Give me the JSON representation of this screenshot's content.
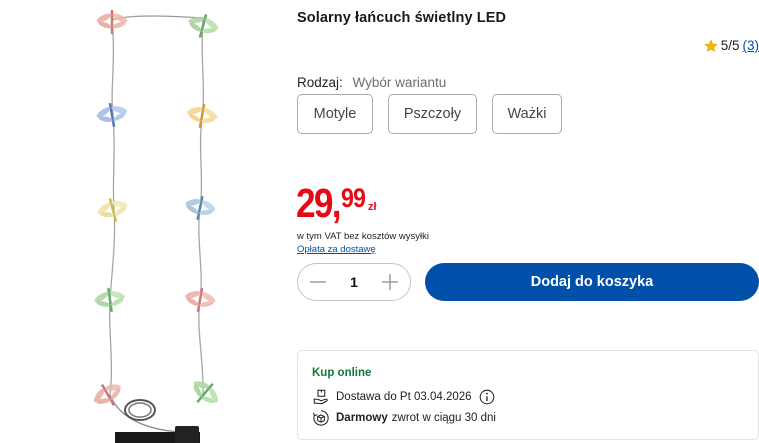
{
  "product": {
    "title": "Solarny łańcuch świetlny LED",
    "rating_score": "5/5",
    "rating_count": "(3)"
  },
  "variant": {
    "label": "Rodzaj:",
    "hint": "Wybór wariantu",
    "options": [
      "Motyle",
      "Pszczoły",
      "Ważki"
    ]
  },
  "price": {
    "main": "29,",
    "cents": "99",
    "currency": "zł",
    "vat_note": "w tym VAT bez kosztów wysyłki",
    "shipping_link": "Opłata za dostawę",
    "color": "#e60a14"
  },
  "cart": {
    "quantity": "1",
    "add_button": "Dodaj do koszyka",
    "accent": "#0050aa"
  },
  "online": {
    "heading": "Kup online",
    "delivery": "Dostawa do Pt 03.04.2026",
    "return_bold": "Darmowy",
    "return_rest": "zwrot w ciągu 30 dni"
  },
  "icons": {
    "rating": "star-icon",
    "minus": "minus-icon",
    "plus": "plus-icon",
    "delivery": "delivery-hand-icon",
    "info": "info-icon",
    "returns": "return-box-icon"
  }
}
